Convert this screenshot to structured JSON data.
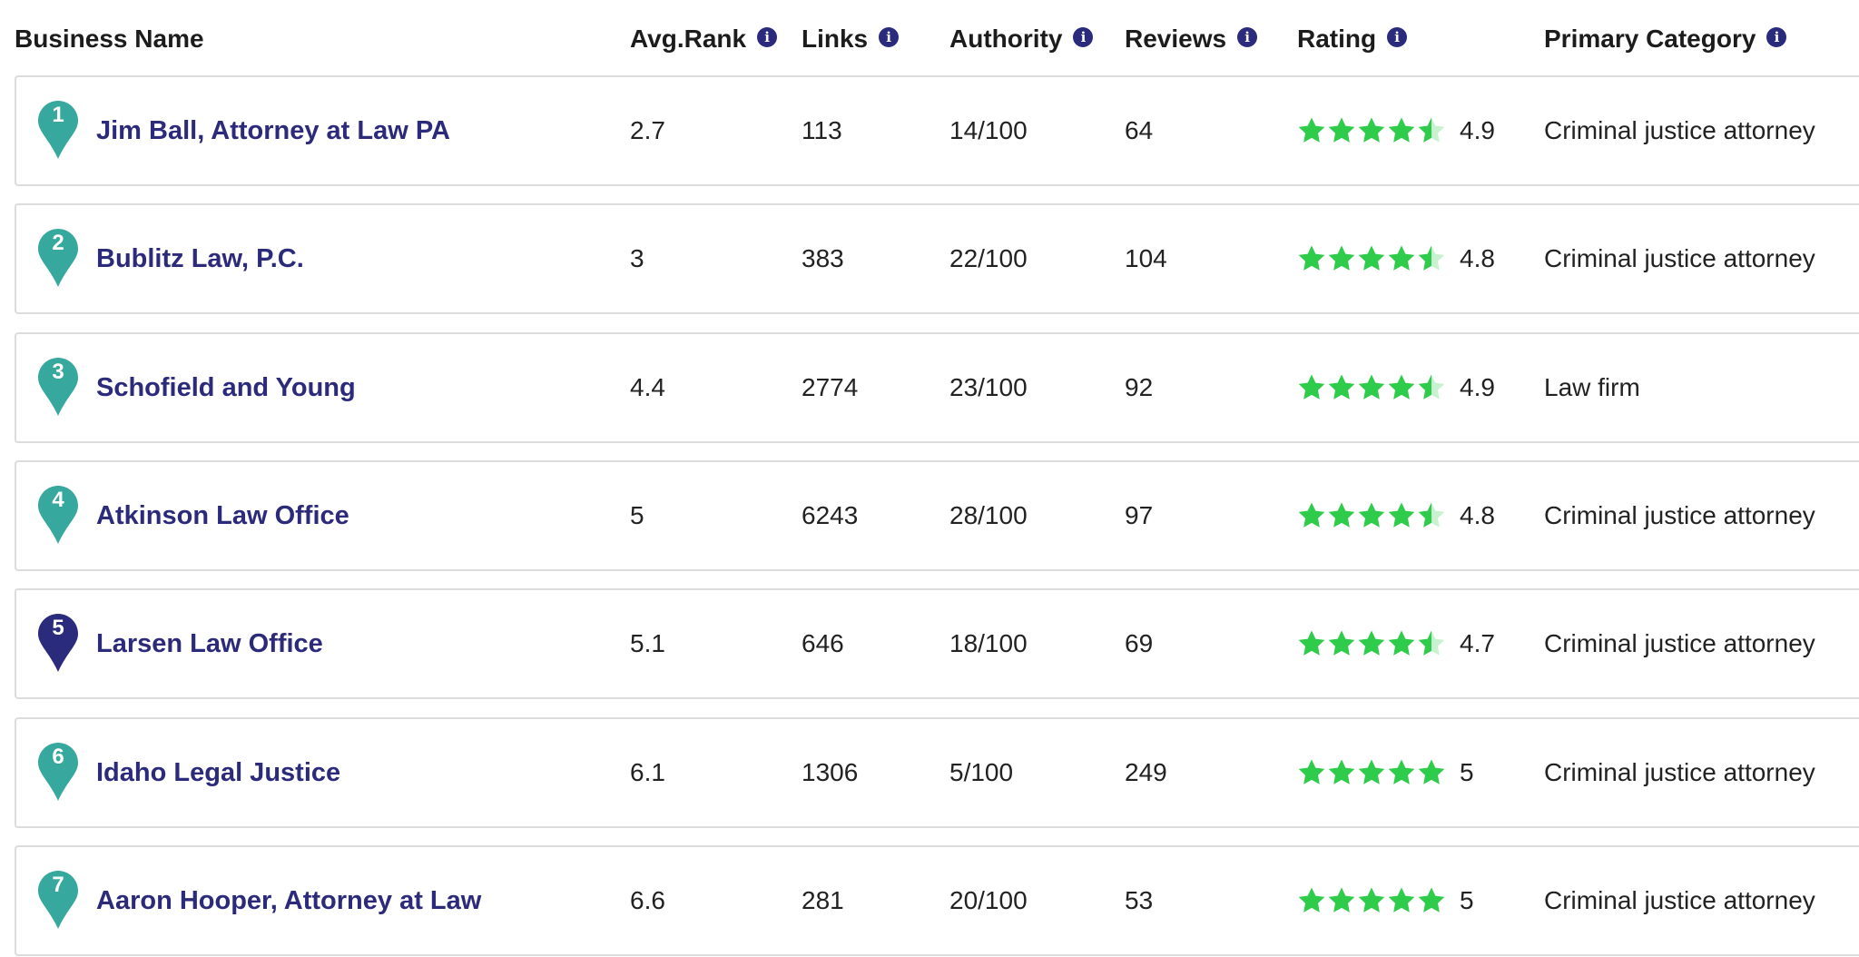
{
  "header": {
    "business_name": "Business Name",
    "avg_rank": "Avg.Rank",
    "links": "Links",
    "authority": "Authority",
    "reviews": "Reviews",
    "rating": "Rating",
    "primary_category": "Primary Category",
    "info_glyph": "i"
  },
  "colors": {
    "pin_default": "#36a89e",
    "pin_highlight": "#2a2b7c",
    "star_fill": "#2ecc4a",
    "star_empty": "#c8f2cf",
    "name_color": "#2c2a7a"
  },
  "rows": [
    {
      "rank": "1",
      "name": "Jim Ball, Attorney at Law PA",
      "avg_rank": "2.7",
      "links": "113",
      "authority": "14/100",
      "reviews": "64",
      "rating": "4.9",
      "rating_value": 4.5,
      "category": "Criminal justice attorney",
      "highlight": false
    },
    {
      "rank": "2",
      "name": "Bublitz Law, P.C.",
      "avg_rank": "3",
      "links": "383",
      "authority": "22/100",
      "reviews": "104",
      "rating": "4.8",
      "rating_value": 4.5,
      "category": "Criminal justice attorney",
      "highlight": false
    },
    {
      "rank": "3",
      "name": "Schofield and Young",
      "avg_rank": "4.4",
      "links": "2774",
      "authority": "23/100",
      "reviews": "92",
      "rating": "4.9",
      "rating_value": 4.5,
      "category": "Law firm",
      "highlight": false
    },
    {
      "rank": "4",
      "name": "Atkinson Law Office",
      "avg_rank": "5",
      "links": "6243",
      "authority": "28/100",
      "reviews": "97",
      "rating": "4.8",
      "rating_value": 4.5,
      "category": "Criminal justice attorney",
      "highlight": false
    },
    {
      "rank": "5",
      "name": "Larsen Law Office",
      "avg_rank": "5.1",
      "links": "646",
      "authority": "18/100",
      "reviews": "69",
      "rating": "4.7",
      "rating_value": 4.5,
      "category": "Criminal justice attorney",
      "highlight": true
    },
    {
      "rank": "6",
      "name": "Idaho Legal Justice",
      "avg_rank": "6.1",
      "links": "1306",
      "authority": "5/100",
      "reviews": "249",
      "rating": "5",
      "rating_value": 5,
      "category": "Criminal justice attorney",
      "highlight": false
    },
    {
      "rank": "7",
      "name": "Aaron Hooper, Attorney at Law",
      "avg_rank": "6.6",
      "links": "281",
      "authority": "20/100",
      "reviews": "53",
      "rating": "5",
      "rating_value": 5,
      "category": "Criminal justice attorney",
      "highlight": false
    }
  ]
}
